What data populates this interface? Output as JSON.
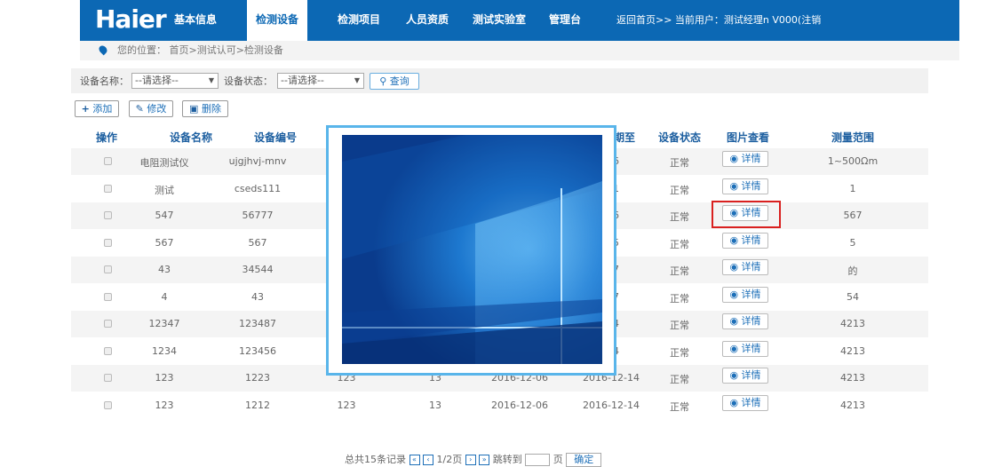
{
  "header": {
    "logo": "Haier",
    "nav": [
      "基本信息",
      "检测设备",
      "检测项目",
      "人员资质",
      "测试实验室",
      "管理台"
    ],
    "active": "检测设备",
    "right": "返回首页>>   当前用户：测试经理n V000(注销"
  },
  "breadcrumb": "您的位置：  首页>测试认可>检测设备",
  "filters": {
    "name_label": "设备名称：",
    "name_value": "--请选择--",
    "status_label": "设备状态：",
    "status_value": "--请选择--",
    "query": "查询"
  },
  "toolbar": {
    "add": "添加",
    "edit": "修改",
    "delete": "删除"
  },
  "table": {
    "headers": [
      "操作",
      "设备名称",
      "设备编号",
      "期至",
      "设备状态",
      "图片查看",
      "测量范围"
    ],
    "detail_label": "详情",
    "rows": [
      {
        "name": "电阻测试仪",
        "code": "ujgjhvj-mnv",
        "c3": "",
        "c4": "",
        "d1": "",
        "d2": "-26",
        "status": "正常",
        "range": "1~500Ωm"
      },
      {
        "name": "测试",
        "code": "cseds111",
        "c3": "",
        "c4": "",
        "d1": "",
        "d2": "-11",
        "status": "正常",
        "range": "1"
      },
      {
        "name": "547",
        "code": "56777",
        "c3": "",
        "c4": "",
        "d1": "",
        "d2": "-26",
        "status": "正常",
        "range": "567"
      },
      {
        "name": "567",
        "code": "567",
        "c3": "",
        "c4": "",
        "d1": "",
        "d2": "-05",
        "status": "正常",
        "range": "5"
      },
      {
        "name": "43",
        "code": "34544",
        "c3": "",
        "c4": "",
        "d1": "",
        "d2": "-27",
        "status": "正常",
        "range": "的"
      },
      {
        "name": "4",
        "code": "43",
        "c3": "",
        "c4": "",
        "d1": "",
        "d2": "-27",
        "status": "正常",
        "range": "54"
      },
      {
        "name": "12347",
        "code": "123487",
        "c3": "",
        "c4": "",
        "d1": "",
        "d2": "-14",
        "status": "正常",
        "range": "4213"
      },
      {
        "name": "1234",
        "code": "123456",
        "c3": "",
        "c4": "",
        "d1": "",
        "d2": "-14",
        "status": "正常",
        "range": "4213"
      },
      {
        "name": "123",
        "code": "1223",
        "c3": "123",
        "c4": "13",
        "d1": "2016-12-06",
        "d2": "2016-12-14",
        "status": "正常",
        "range": "4213"
      },
      {
        "name": "123",
        "code": "1212",
        "c3": "123",
        "c4": "13",
        "d1": "2016-12-06",
        "d2": "2016-12-14",
        "status": "正常",
        "range": "4213"
      }
    ]
  },
  "pager": {
    "total": "总共15条记录",
    "page": "1/2页",
    "jump": "跳转到",
    "unit": "页",
    "ok": "确定"
  }
}
